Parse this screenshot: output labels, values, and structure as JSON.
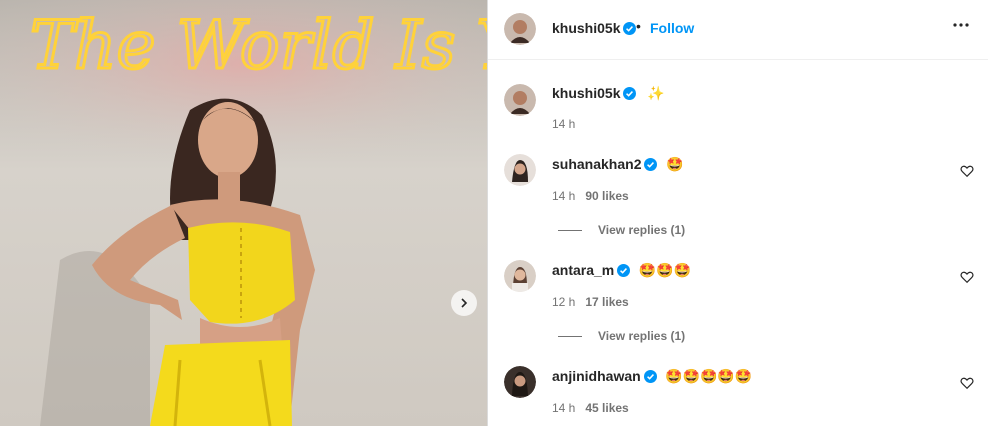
{
  "post_image": {
    "neon_text": "The World Is Your",
    "next_icon": "chevron-right-icon"
  },
  "header": {
    "username": "khushi05k",
    "follow_label": "Follow",
    "dot": "•",
    "more_icon": "more-horizontal-icon"
  },
  "caption": {
    "username": "khushi05k",
    "emoji": "✨",
    "time": "14 h"
  },
  "comments": [
    {
      "username": "suhanakhan2",
      "emojis": "🤩",
      "time": "14 h",
      "likes": "90 likes",
      "replies": "View replies (1)"
    },
    {
      "username": "antara_m",
      "emojis": "🤩🤩🤩",
      "time": "12 h",
      "likes": "17 likes",
      "replies": "View replies (1)"
    },
    {
      "username": "anjinidhawan",
      "emojis": "🤩🤩🤩🤩🤩",
      "time": "14 h",
      "likes": "45 likes"
    }
  ],
  "colors": {
    "accent": "#0095f6",
    "verified": "#0095f6",
    "neon": "#ffd23a"
  }
}
